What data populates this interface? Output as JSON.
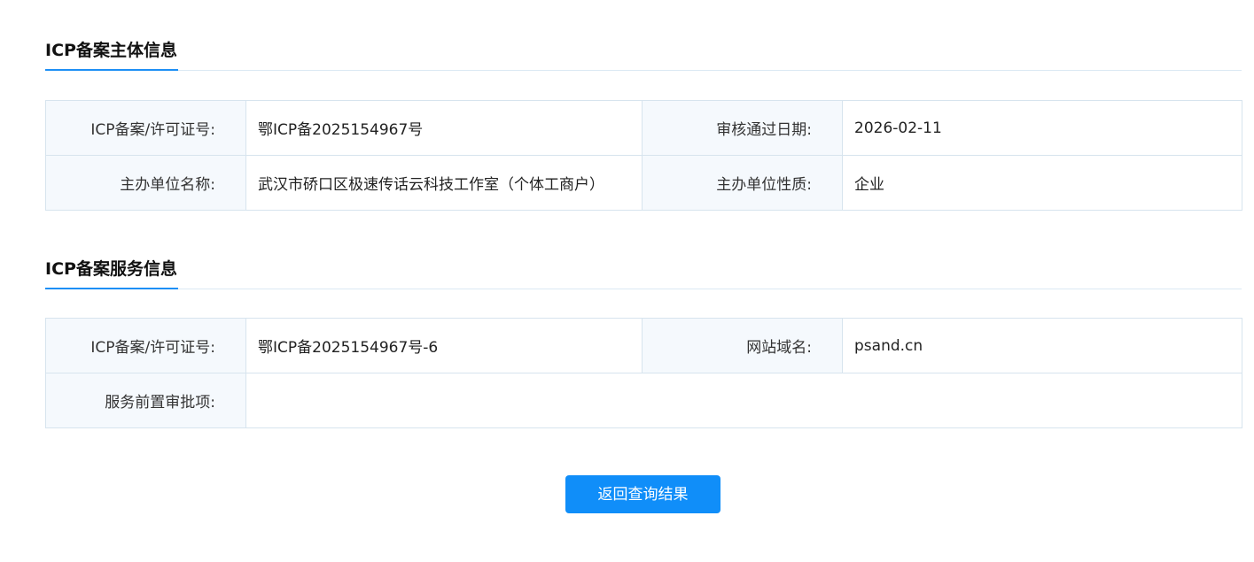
{
  "subject_section": {
    "title": "ICP备案主体信息",
    "rows": [
      {
        "label1": "ICP备案/许可证号:",
        "value1": "鄂ICP备2025154967号",
        "label2": "审核通过日期:",
        "value2": "2026-02-11"
      },
      {
        "label1": "主办单位名称:",
        "value1": "武汉市硚口区极速传话云科技工作室（个体工商户）",
        "label2": "主办单位性质:",
        "value2": "企业"
      }
    ]
  },
  "service_section": {
    "title": "ICP备案服务信息",
    "row1": {
      "label1": "ICP备案/许可证号:",
      "value1": "鄂ICP备2025154967号-6",
      "label2": "网站域名:",
      "value2": "psand.cn"
    },
    "row2": {
      "label1": "服务前置审批项:",
      "value1": ""
    }
  },
  "actions": {
    "return_label": "返回查询结果"
  },
  "colors": {
    "accent": "#1d8ff5",
    "button": "#108ef9",
    "label_bg": "#f5f9fd",
    "border": "#d7e4ee"
  }
}
